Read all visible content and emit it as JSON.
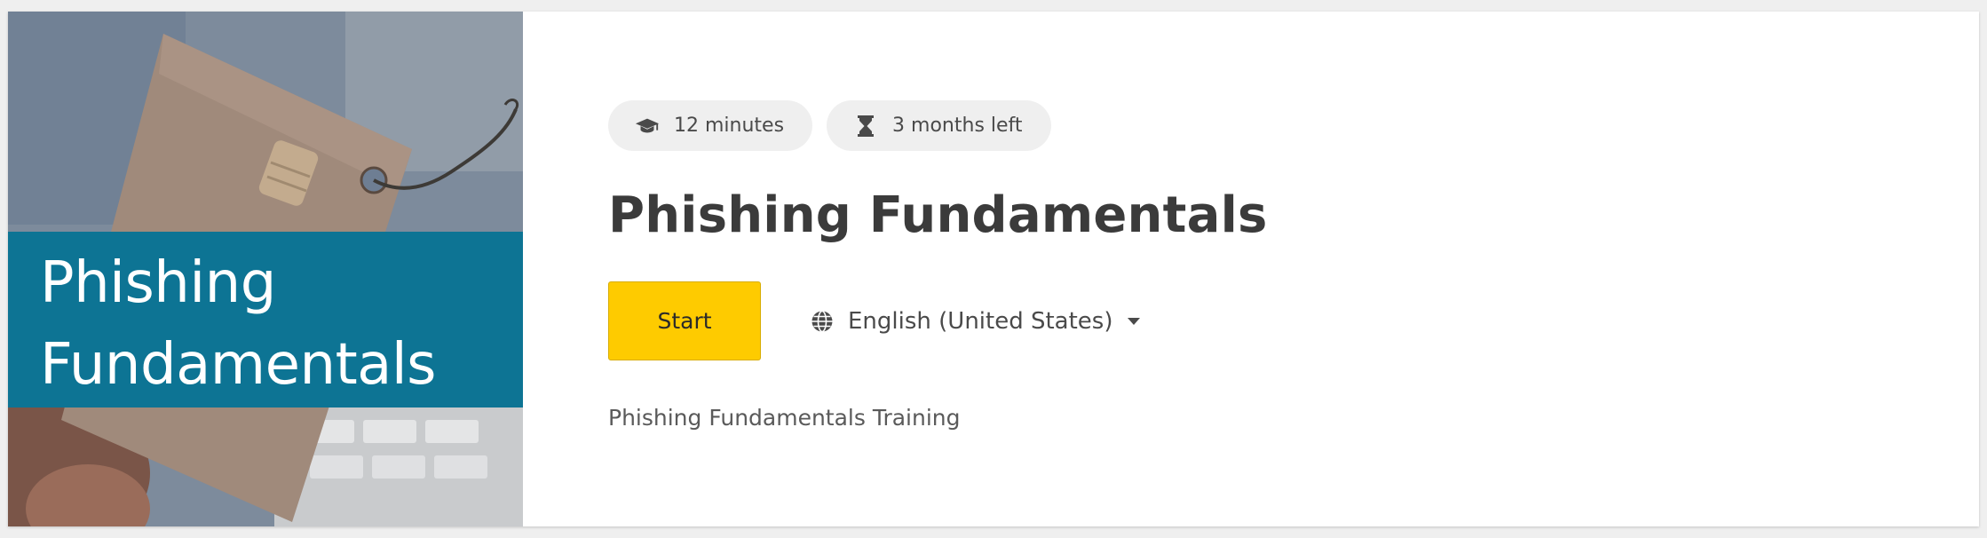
{
  "course": {
    "thumbnail": {
      "line1": "Phishing",
      "line2": "Fundamentals",
      "banner_color": "#0d7494"
    },
    "duration": {
      "icon": "graduation-cap-icon",
      "label": "12 minutes"
    },
    "deadline": {
      "icon": "hourglass-icon",
      "label": "3 months left"
    },
    "title": "Phishing Fundamentals",
    "start_button": {
      "label": "Start",
      "color": "#fecb00"
    },
    "language": {
      "icon": "globe-icon",
      "selected": "English (United States)"
    },
    "description": "Phishing Fundamentals Training"
  }
}
